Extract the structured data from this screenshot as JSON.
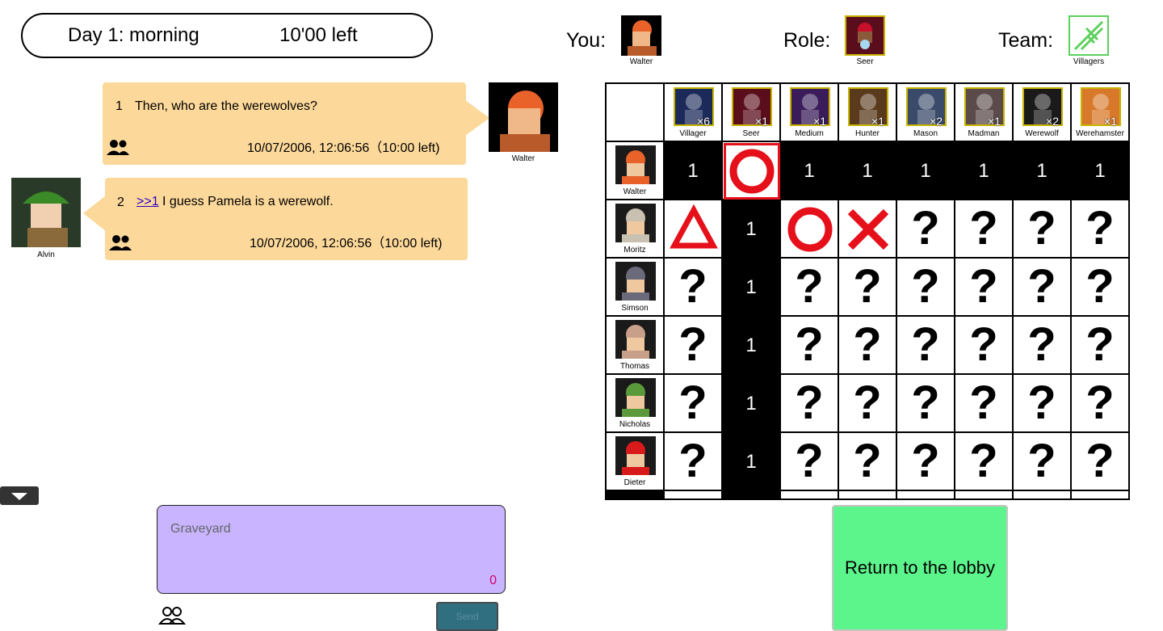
{
  "status": {
    "phase": "Day 1: morning",
    "time_left": "10'00 left"
  },
  "info": {
    "you_label": "You:",
    "you_name": "Walter",
    "role_label": "Role:",
    "role_name": "Seer",
    "team_label": "Team:",
    "team_name": "Villagers"
  },
  "messages": [
    {
      "num": "1",
      "anchor": "",
      "text": "Then, who are the werewolves?",
      "time": "10/07/2006, 12:06:56（10:00 left)",
      "speaker": "Walter",
      "side": "right"
    },
    {
      "num": "2",
      "anchor": ">>1",
      "text": " I guess Pamela is a werewolf.",
      "time": "10/07/2006, 12:06:56（10:00 left)",
      "speaker": "Alvin",
      "side": "left"
    }
  ],
  "input": {
    "placeholder": "Graveyard",
    "char_count": "0",
    "send_label": "Send"
  },
  "lobby_button": "Return to the lobby",
  "roles": [
    {
      "name": "Villager",
      "count": "×6"
    },
    {
      "name": "Seer",
      "count": "×1"
    },
    {
      "name": "Medium",
      "count": "×1"
    },
    {
      "name": "Hunter",
      "count": "×1"
    },
    {
      "name": "Mason",
      "count": "×2"
    },
    {
      "name": "Madman",
      "count": "×1"
    },
    {
      "name": "Werewolf",
      "count": "×2"
    },
    {
      "name": "Werehamster",
      "count": "×1"
    }
  ],
  "players": [
    {
      "name": "Walter",
      "cells": [
        "1",
        "circle-selected",
        "1",
        "1",
        "1",
        "1",
        "1",
        "1"
      ]
    },
    {
      "name": "Moritz",
      "cells": [
        "triangle",
        "1",
        "circle",
        "cross",
        "?",
        "?",
        "?",
        "?"
      ]
    },
    {
      "name": "Simson",
      "cells": [
        "?",
        "1",
        "?",
        "?",
        "?",
        "?",
        "?",
        "?"
      ]
    },
    {
      "name": "Thomas",
      "cells": [
        "?",
        "1",
        "?",
        "?",
        "?",
        "?",
        "?",
        "?"
      ]
    },
    {
      "name": "Nicholas",
      "cells": [
        "?",
        "1",
        "?",
        "?",
        "?",
        "?",
        "?",
        "?"
      ]
    },
    {
      "name": "Dieter",
      "cells": [
        "?",
        "1",
        "?",
        "?",
        "?",
        "?",
        "?",
        "?"
      ]
    }
  ],
  "colors": {
    "message_bg": "#fcd89a",
    "input_bg": "#c8b4ff",
    "lobby_bg": "#5cf58c",
    "mark_red": "#e5101a"
  }
}
